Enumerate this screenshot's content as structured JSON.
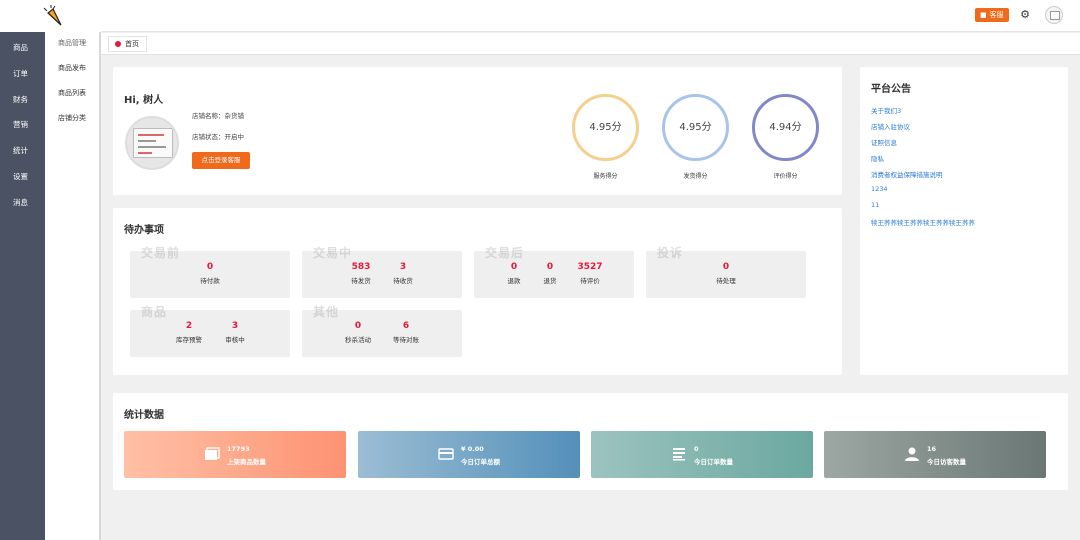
{
  "sidebar": {
    "items": [
      {
        "label": "商品"
      },
      {
        "label": "订单"
      },
      {
        "label": "财务"
      },
      {
        "label": "营销"
      },
      {
        "label": "统计"
      },
      {
        "label": "设置"
      },
      {
        "label": "消息"
      }
    ]
  },
  "submenu": {
    "header": "商品管理",
    "items": [
      {
        "label": "商品发布"
      },
      {
        "label": "商品列表"
      },
      {
        "label": "店铺分类"
      }
    ]
  },
  "header": {
    "customer_service_label": "客服",
    "icons": [
      "chat-icon",
      "gear-icon",
      "avatar"
    ]
  },
  "tabs": [
    {
      "label": "首页"
    }
  ],
  "welcome": {
    "greeting": "Hi, 树人",
    "shop_name": "店铺名称：杂货铺",
    "shop_status": "店铺状态：开启中",
    "login_cs_button": "点击登录客服"
  },
  "ratings": [
    {
      "value": "4.95分",
      "label": "服务得分",
      "color": "#f5cf8e"
    },
    {
      "value": "4.95分",
      "label": "发货得分",
      "color": "#a8c4e8"
    },
    {
      "value": "4.94分",
      "label": "评价得分",
      "color": "#8088c9"
    }
  ],
  "todo": {
    "title": "待办事项",
    "groups": [
      {
        "watermark": "交易前",
        "metrics": [
          {
            "value": "0",
            "label": "待付款"
          }
        ]
      },
      {
        "watermark": "交易中",
        "metrics": [
          {
            "value": "583",
            "label": "待发货"
          },
          {
            "value": "3",
            "label": "待收货"
          }
        ]
      },
      {
        "watermark": "交易后",
        "metrics": [
          {
            "value": "0",
            "label": "退款"
          },
          {
            "value": "0",
            "label": "退货"
          },
          {
            "value": "3527",
            "label": "待评价"
          }
        ]
      },
      {
        "watermark": "投诉",
        "metrics": [
          {
            "value": "0",
            "label": "待处理"
          }
        ]
      },
      {
        "watermark": "商品",
        "metrics": [
          {
            "value": "2",
            "label": "库存预警"
          },
          {
            "value": "3",
            "label": "审核中"
          }
        ]
      },
      {
        "watermark": "其他",
        "metrics": [
          {
            "value": "0",
            "label": "秒杀活动"
          },
          {
            "value": "6",
            "label": "等待对账"
          }
        ]
      }
    ]
  },
  "notice": {
    "title": "平台公告",
    "links": [
      {
        "label": "关于我们3"
      },
      {
        "label": "店铺入驻协议"
      },
      {
        "label": "证照信息"
      },
      {
        "label": "隐私"
      },
      {
        "label": "消费者权益保障措施说明"
      },
      {
        "label": "1234"
      },
      {
        "label": "11"
      },
      {
        "label": "犊王荞荞犊王荞荞犊王荞荞犊王荞荞"
      }
    ]
  },
  "stats": {
    "title": "统计数据",
    "cards": [
      {
        "value": "17793",
        "label": "上架商品数量",
        "icon": "images-icon",
        "colors": [
          "#ffc0a6",
          "#fd9272"
        ]
      },
      {
        "value": "¥ 0.00",
        "label": "今日订单总额",
        "icon": "credit-card-icon",
        "colors": [
          "#9bbdd4",
          "#5490ba"
        ]
      },
      {
        "value": "0",
        "label": "今日订单数量",
        "icon": "list-icon",
        "colors": [
          "#9cc3bf",
          "#6ba8a0"
        ]
      },
      {
        "value": "16",
        "label": "今日访客数量",
        "icon": "user-icon",
        "colors": [
          "#9da7a3",
          "#6a7774"
        ]
      }
    ]
  }
}
